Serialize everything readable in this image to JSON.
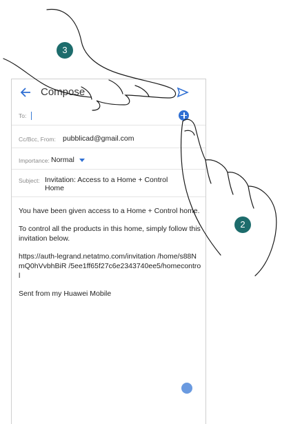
{
  "appbar": {
    "title": "Compose",
    "back_icon": "arrow-left-icon",
    "send_icon": "send-icon"
  },
  "to_field": {
    "label": "To:"
  },
  "cc_field": {
    "label": "Cc/Bcc, From:",
    "value": "pubblicad@gmail.com"
  },
  "importance_field": {
    "label": "Importance:",
    "value": "Normal"
  },
  "subject_field": {
    "label": "Subject:",
    "value": "Invitation: Access to a Home + Control Home"
  },
  "body": {
    "p1": "You have been given access to a Home + Control home.",
    "p2": "To control all the products in this home, simply follow this invitation below.",
    "link": "https://auth-legrand.netatmo.com/invitation /home/s88NmQ0hVvbhBiR /5ee1ff65f27c6e2343740ee5/homecontrol",
    "signature": "Sent from my Huawei Mobile"
  },
  "callouts": {
    "step_2": "2",
    "step_3": "3"
  },
  "colors": {
    "accent": "#2f6fd3",
    "badge": "#1d6c6c"
  }
}
